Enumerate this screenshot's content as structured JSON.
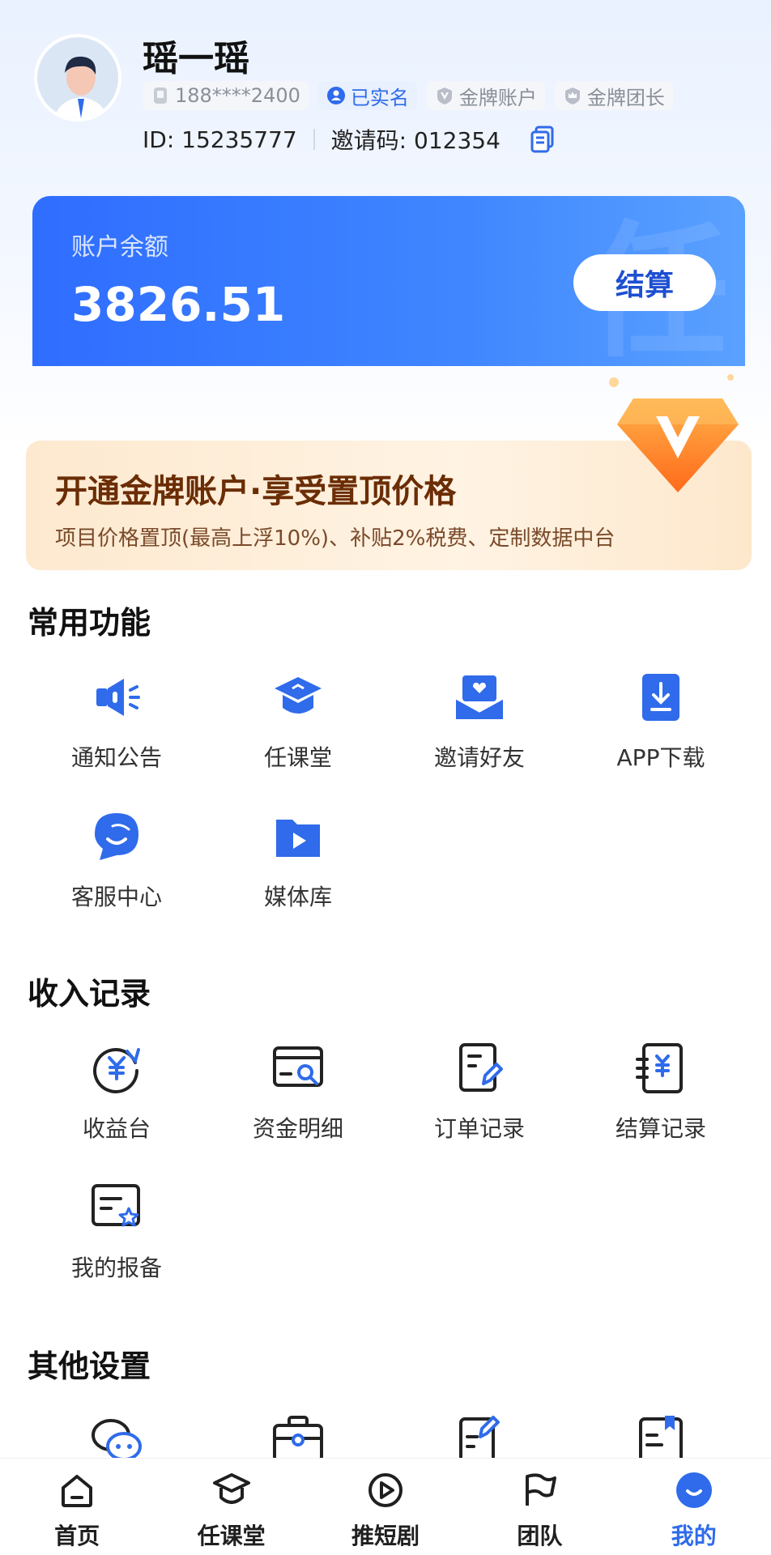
{
  "profile": {
    "name": "瑶一瑶",
    "phone": "188****2400",
    "badges": [
      "已实名",
      "金牌账户",
      "金牌团长"
    ],
    "id_text": "ID: 15235777",
    "invite_text": "邀请码: 012354"
  },
  "balance": {
    "label": "账户余额",
    "value": "3826.51",
    "button": "结算"
  },
  "promo": {
    "title": "开通金牌账户·享受置顶价格",
    "subtitle": "项目价格置顶(最高上浮10%)、补贴2%税费、定制数据中台"
  },
  "sections": {
    "common": {
      "title": "常用功能",
      "items": [
        {
          "label": "通知公告",
          "icon": "megaphone-icon"
        },
        {
          "label": "任课堂",
          "icon": "graduation-cap-icon"
        },
        {
          "label": "邀请好友",
          "icon": "invite-envelope-icon"
        },
        {
          "label": "APP下载",
          "icon": "download-icon"
        },
        {
          "label": "客服中心",
          "icon": "chat-bubble-icon"
        },
        {
          "label": "媒体库",
          "icon": "video-folder-icon"
        }
      ]
    },
    "income": {
      "title": "收入记录",
      "items": [
        {
          "label": "收益台",
          "icon": "yuan-refresh-icon"
        },
        {
          "label": "资金明细",
          "icon": "card-search-icon"
        },
        {
          "label": "订单记录",
          "icon": "document-edit-icon"
        },
        {
          "label": "结算记录",
          "icon": "yuan-document-icon"
        },
        {
          "label": "我的报备",
          "icon": "report-star-icon"
        }
      ]
    },
    "other": {
      "title": "其他设置",
      "items": [
        {
          "label": "",
          "icon": "wechat-chat-icon"
        },
        {
          "label": "",
          "icon": "briefcase-icon"
        },
        {
          "label": "",
          "icon": "note-edit-icon"
        },
        {
          "label": "",
          "icon": "bookmark-book-icon"
        }
      ]
    }
  },
  "nav": [
    {
      "label": "首页",
      "icon": "home-icon"
    },
    {
      "label": "任课堂",
      "icon": "graduation-cap-icon"
    },
    {
      "label": "推短剧",
      "icon": "play-circle-icon"
    },
    {
      "label": "团队",
      "icon": "flag-icon"
    },
    {
      "label": "我的",
      "icon": "profile-smile-icon",
      "active": true
    }
  ],
  "colors": {
    "accent": "#2f6bea",
    "promo_title": "#6b2d05"
  }
}
